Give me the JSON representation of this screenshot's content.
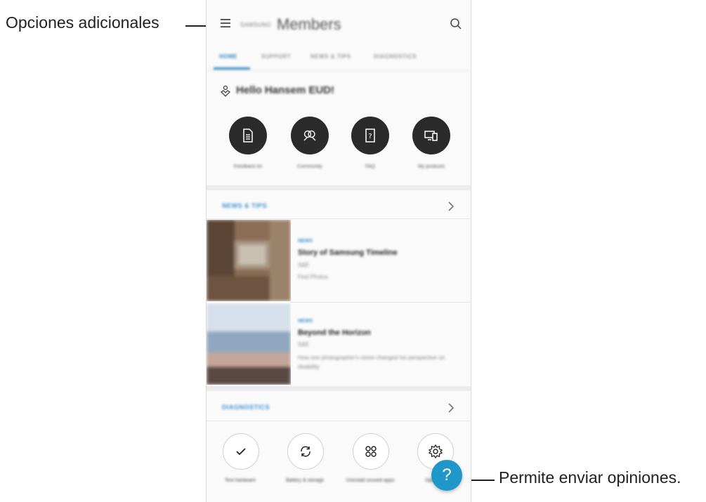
{
  "annotations": {
    "more_options": "Opciones adicionales",
    "feedback": "Permite enviar opiniones."
  },
  "app": {
    "brand_small": "SAMSUNG",
    "title": "Members",
    "tabs": [
      {
        "label": "HOME",
        "active": true
      },
      {
        "label": "SUPPORT",
        "active": false
      },
      {
        "label": "NEWS & TIPS",
        "active": false
      },
      {
        "label": "DIAGNOSTICS",
        "active": false
      }
    ],
    "greeting": "Hello Hansem EUD!",
    "quick_actions": [
      {
        "label": "Feedback tm",
        "icon": "document-icon"
      },
      {
        "label": "Community",
        "icon": "people-icon"
      },
      {
        "label": "FAQ",
        "icon": "question-book-icon"
      },
      {
        "label": "My products",
        "icon": "devices-icon"
      }
    ],
    "news_section": {
      "title": "NEWS & TIPS",
      "articles": [
        {
          "tag": "NEWS",
          "title": "Story of Samsung Timeline",
          "source": "S&E",
          "sub": "Find Photos",
          "desc": ""
        },
        {
          "tag": "NEWS",
          "title": "Beyond the Horizon",
          "source": "S&E",
          "sub": "",
          "desc": "How one photographer's vision changed his perspective on disability"
        }
      ]
    },
    "diagnostics_section": {
      "title": "DIAGNOSTICS",
      "items": [
        {
          "label": "Test hardware",
          "icon": "check-icon"
        },
        {
          "label": "Battery & storage",
          "icon": "sync-icon"
        },
        {
          "label": "Uninstall unused apps",
          "icon": "apps-icon"
        },
        {
          "label": "Optimize",
          "icon": "gear-icon"
        }
      ]
    },
    "fab_label": "?"
  },
  "colors": {
    "accent": "#2e86c1",
    "fab": "#1f98c9",
    "quick_action_bg": "#2b2b2b"
  }
}
